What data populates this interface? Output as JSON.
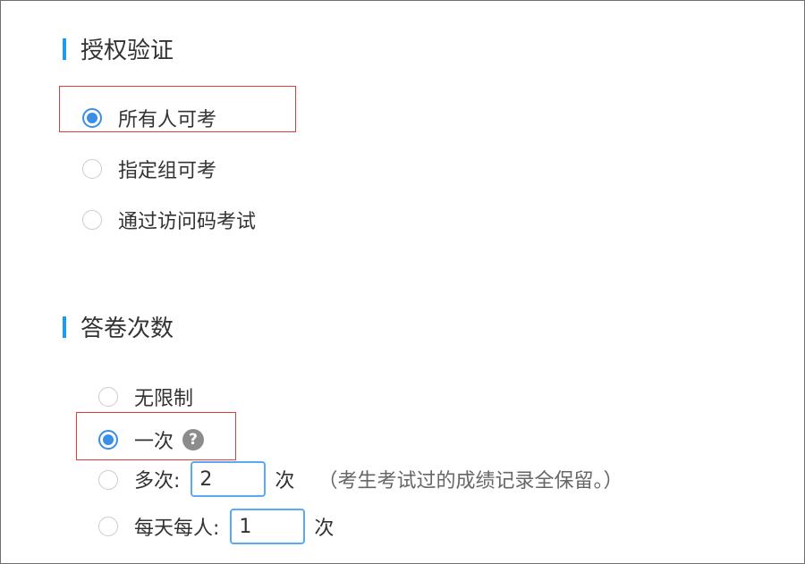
{
  "auth": {
    "title": "授权验证",
    "options": [
      {
        "label": "所有人可考",
        "checked": true
      },
      {
        "label": "指定组可考",
        "checked": false
      },
      {
        "label": "通过访问码考试",
        "checked": false
      }
    ]
  },
  "attempts": {
    "title": "答卷次数",
    "unlimited_label": "无限制",
    "once_label": "一次",
    "help_icon": "?",
    "multiple": {
      "label": "多次:",
      "value": "2",
      "unit": "次",
      "note": "（考生考试过的成绩记录全保留。）"
    },
    "daily": {
      "label": "每天每人:",
      "value": "1",
      "unit": "次"
    }
  },
  "colors": {
    "accent": "#3a8ee6",
    "title_bar": "#1d9bf0",
    "highlight_box": "#e23a3a"
  }
}
